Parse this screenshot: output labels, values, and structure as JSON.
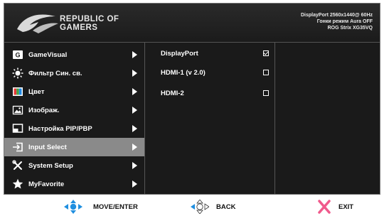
{
  "header": {
    "brand_line1": "REPUBLIC OF",
    "brand_line2": "GAMERS",
    "info_line1": "DisplayPort 2560x1440@ 60Hz",
    "info_line2": "Гонки режим Aura OFF",
    "info_line3": "ROG Strix XG35VQ"
  },
  "menu": [
    {
      "label": "GameVisual",
      "icon": "gamevisual-icon"
    },
    {
      "label": "Фильтр Син. св.",
      "icon": "blue-light-filter-icon"
    },
    {
      "label": "Цвет",
      "icon": "color-icon"
    },
    {
      "label": "Изображ.",
      "icon": "image-icon"
    },
    {
      "label": "Настройка PIP/PBP",
      "icon": "pip-pbp-icon"
    },
    {
      "label": "Input Select",
      "icon": "input-select-icon",
      "active": true
    },
    {
      "label": "System Setup",
      "icon": "system-setup-icon"
    },
    {
      "label": "MyFavorite",
      "icon": "favorite-star-icon"
    }
  ],
  "submenu": [
    {
      "label": "DisplayPort",
      "checked": true
    },
    {
      "label": "HDMI-1 (v 2.0)",
      "checked": false
    },
    {
      "label": "HDMI-2",
      "checked": false
    }
  ],
  "footer": {
    "move_label": "MOVE/ENTER",
    "back_label": "BACK",
    "exit_label": "EXIT"
  },
  "colors": {
    "osd_bg": "#1a1a1a",
    "active_row": "#8a8a8a",
    "accent_blue": "#1f8fe0",
    "exit_pink": "#f05a8c"
  }
}
